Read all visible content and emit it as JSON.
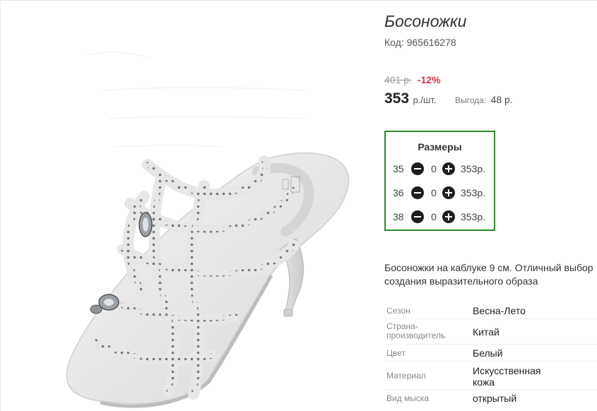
{
  "product": {
    "title": "Босоножки",
    "code_label": "Код:",
    "code": "965616278",
    "old_price": "401 р.",
    "discount": "-12%",
    "price": "353",
    "price_unit": "р./шт.",
    "savings_label": "Выгода:",
    "savings_value": "48 р.",
    "image_name": "white-heeled-sandal-with-rhinestones"
  },
  "sizes": {
    "title": "Размеры",
    "rows": [
      {
        "size": "35",
        "qty": "0",
        "price": "353р."
      },
      {
        "size": "36",
        "qty": "0",
        "price": "353р."
      },
      {
        "size": "38",
        "qty": "0",
        "price": "353р."
      }
    ],
    "minus_icon": "minus-circle-icon",
    "plus_icon": "plus-circle-icon"
  },
  "description": "Босоножки на каблуке 9 см. Отличный выбор создания выразительного образа",
  "specs": [
    {
      "label": "Сезон",
      "value": "Весна-Лето"
    },
    {
      "label": "Страна-производитель",
      "value": "Китай"
    },
    {
      "label": "Цвет",
      "value": "Белый"
    },
    {
      "label": "Материал",
      "value": "Искусственная кожа"
    },
    {
      "label": "Вид мыска",
      "value": "открытый"
    }
  ],
  "colors": {
    "sizes_border": "#2b8a2b",
    "discount": "#e0314b",
    "button": "#1e1e1e"
  }
}
